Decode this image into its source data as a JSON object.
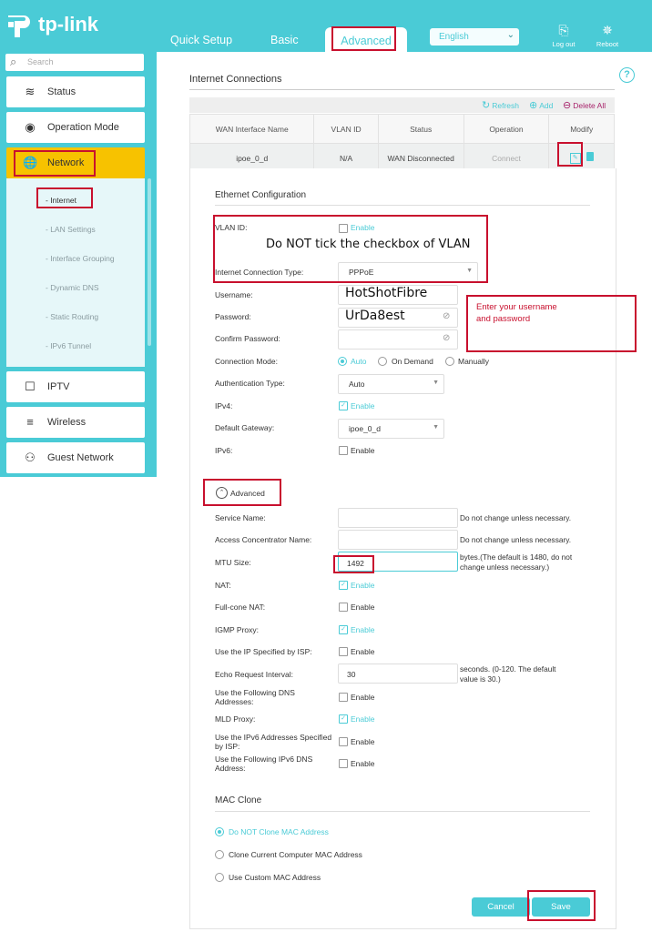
{
  "header": {
    "brand": "tp-link",
    "tabs": [
      {
        "label": "Quick Setup"
      },
      {
        "label": "Basic"
      },
      {
        "label": "Advanced"
      }
    ],
    "language": "English",
    "logout_label": "Log out",
    "reboot_label": "Reboot"
  },
  "sidebar": {
    "search_placeholder": "Search",
    "items": [
      {
        "label": "Status",
        "icon": "pulse-icon"
      },
      {
        "label": "Operation Mode",
        "icon": "toggle-icon"
      },
      {
        "label": "Network",
        "icon": "globe-icon"
      },
      {
        "label": "IPTV",
        "icon": "monitor-icon"
      },
      {
        "label": "Wireless",
        "icon": "wifi-icon"
      },
      {
        "label": "Guest Network",
        "icon": "guest-users-icon"
      }
    ],
    "network_sub": [
      {
        "label": "- Internet"
      },
      {
        "label": "- LAN Settings"
      },
      {
        "label": "- Interface Grouping"
      },
      {
        "label": "- Dynamic DNS"
      },
      {
        "label": "- Static Routing"
      },
      {
        "label": "- IPv6 Tunnel"
      }
    ]
  },
  "internet": {
    "title": "Internet Connections",
    "toolbar": {
      "refresh": "Refresh",
      "add": "Add",
      "delete_all": "Delete All"
    },
    "columns": [
      "WAN Interface Name",
      "VLAN ID",
      "Status",
      "Operation",
      "Modify"
    ],
    "rows": [
      {
        "name": "ipoe_0_d",
        "vlan": "N/A",
        "status": "WAN Disconnected",
        "operation": "Connect"
      }
    ]
  },
  "ethernet": {
    "title": "Ethernet Configuration",
    "vlan_label": "VLAN ID:",
    "vlan_enable": "Enable",
    "conn_type_label": "Internet Connection Type:",
    "conn_type_value": "PPPoE",
    "username_label": "Username:",
    "username_value": "HotShotFibre",
    "password_label": "Password:",
    "password_value": "UrDa8est",
    "confirm_label": "Confirm Password:",
    "mode_label": "Connection Mode:",
    "mode_options": [
      "Auto",
      "On Demand",
      "Manually"
    ],
    "mode_selected": "Auto",
    "auth_label": "Authentication Type:",
    "auth_value": "Auto",
    "ipv4_label": "IPv4:",
    "ipv4_enable": "Enable",
    "gateway_label": "Default Gateway:",
    "gateway_value": "ipoe_0_d",
    "ipv6_label": "IPv6:",
    "ipv6_enable": "Enable"
  },
  "advanced": {
    "toggle_label": "Advanced",
    "service_label": "Service Name:",
    "service_hint": "Do not change unless necessary.",
    "ac_label": "Access Concentrator Name:",
    "ac_hint": "Do not change unless necessary.",
    "mtu_label": "MTU Size:",
    "mtu_value": "1492",
    "mtu_hint_1": "bytes.(The default is 1480, do not",
    "mtu_hint_2": "change unless necessary.)",
    "nat_label": "NAT:",
    "fullcone_label": "Full-cone NAT:",
    "igmp_label": "IGMP Proxy:",
    "useip_label": "Use the IP Specified by ISP:",
    "echo_label": "Echo Request Interval:",
    "echo_value": "30",
    "echo_hint_1": "seconds. (0-120. The default",
    "echo_hint_2": "value is 30.)",
    "dns_label_1": "Use the Following DNS",
    "dns_label_2": "Addresses:",
    "mld_label": "MLD Proxy:",
    "ipv6isp_label_1": "Use the IPv6 Addresses Specified",
    "ipv6isp_label_2": "by ISP:",
    "ipv6dns_label_1": "Use the Following IPv6 DNS",
    "ipv6dns_label_2": "Address:",
    "enable": "Enable"
  },
  "mac_clone": {
    "title": "MAC Clone",
    "options": [
      "Do NOT Clone MAC Address",
      "Clone Current Computer MAC Address",
      "Use Custom MAC Address"
    ],
    "selected": "Do NOT Clone MAC Address"
  },
  "buttons": {
    "cancel": "Cancel",
    "save": "Save"
  },
  "annotations": {
    "vlan_note": "Do NOT tick the checkbox of VLAN",
    "cred_note_1": "Enter your username",
    "cred_note_2": "and password"
  },
  "colors": {
    "accent": "#4acbd6",
    "highlight": "#f7c200",
    "annotation_red": "#c8102e"
  }
}
